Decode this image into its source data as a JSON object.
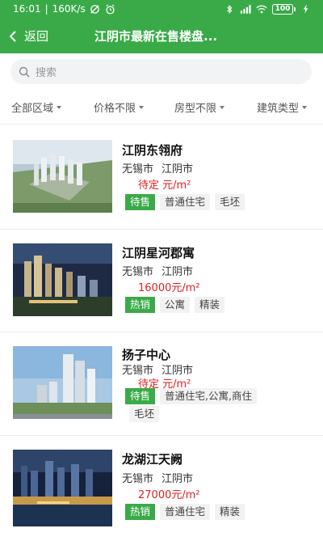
{
  "statusbar": {
    "time": "16:01",
    "speed": "160K/s",
    "battery": "100"
  },
  "nav": {
    "back_label": "返回",
    "title": "江阴市最新在售楼盘..."
  },
  "search": {
    "placeholder": "搜索"
  },
  "filters": [
    {
      "label": "全部区域"
    },
    {
      "label": "价格不限"
    },
    {
      "label": "房型不限"
    },
    {
      "label": "建筑类型"
    }
  ],
  "listings": [
    {
      "name": "江阴东翎府",
      "city": "无锡市",
      "district": "江阴市",
      "price_value": "待定",
      "price_unit": "元/m²",
      "status": "待售",
      "tags": [
        "普通住宅",
        "毛坯"
      ],
      "extra_tags": []
    },
    {
      "name": "江阴星河郡寓",
      "city": "无锡市",
      "district": "江阴市",
      "price_value": "16000",
      "price_unit": "元/m²",
      "status": "热销",
      "tags": [
        "公寓",
        "精装"
      ],
      "extra_tags": []
    },
    {
      "name": "扬子中心",
      "city": "无锡市",
      "district": "江阴市",
      "price_value": "待定",
      "price_unit": "元/m²",
      "status": "待售",
      "tags": [
        "普通住宅,公寓,商住"
      ],
      "extra_tags": [
        "毛坯"
      ]
    },
    {
      "name": "龙湖江天阙",
      "city": "无锡市",
      "district": "江阴市",
      "price_value": "27000",
      "price_unit": "元/m²",
      "status": "热销",
      "tags": [
        "普通住宅",
        "精装"
      ],
      "extra_tags": []
    }
  ],
  "colors": {
    "brand_green": "#3aaa49",
    "price_red": "#e02020"
  }
}
